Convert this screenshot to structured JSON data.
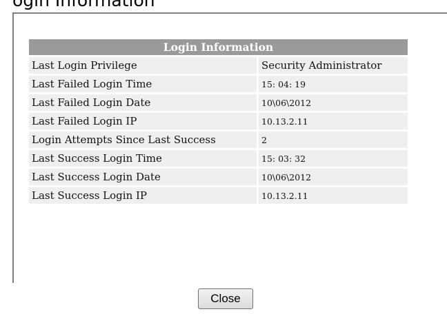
{
  "top_fragment": "ogin Information",
  "table": {
    "title": "Login Information",
    "rows": [
      {
        "label": "Last Login Privilege",
        "value": "Security Administrator"
      },
      {
        "label": "Last Failed Login Time",
        "value": "15: 04: 19"
      },
      {
        "label": "Last Failed Login Date",
        "value": "10\\06\\2012"
      },
      {
        "label": "Last Failed Login IP",
        "value": "10.13.2.11"
      },
      {
        "label": "Login Attempts Since Last Success",
        "value": "2"
      },
      {
        "label": "Last Success Login Time",
        "value": "15: 03: 32"
      },
      {
        "label": "Last Success Login Date",
        "value": "10\\06\\2012"
      },
      {
        "label": "Last Success Login IP",
        "value": "10.13.2.11"
      }
    ]
  },
  "close_label": "Close"
}
